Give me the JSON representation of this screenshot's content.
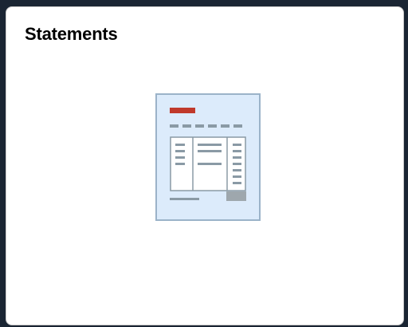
{
  "tile": {
    "title": "Statements"
  },
  "icon": {
    "name": "statement-document-icon",
    "page_color": "#dcebfb",
    "page_border": "#9bb3c9",
    "accent_color": "#c0392b",
    "line_color": "#8a9aa5",
    "total_box_color": "#9ea7ad"
  }
}
